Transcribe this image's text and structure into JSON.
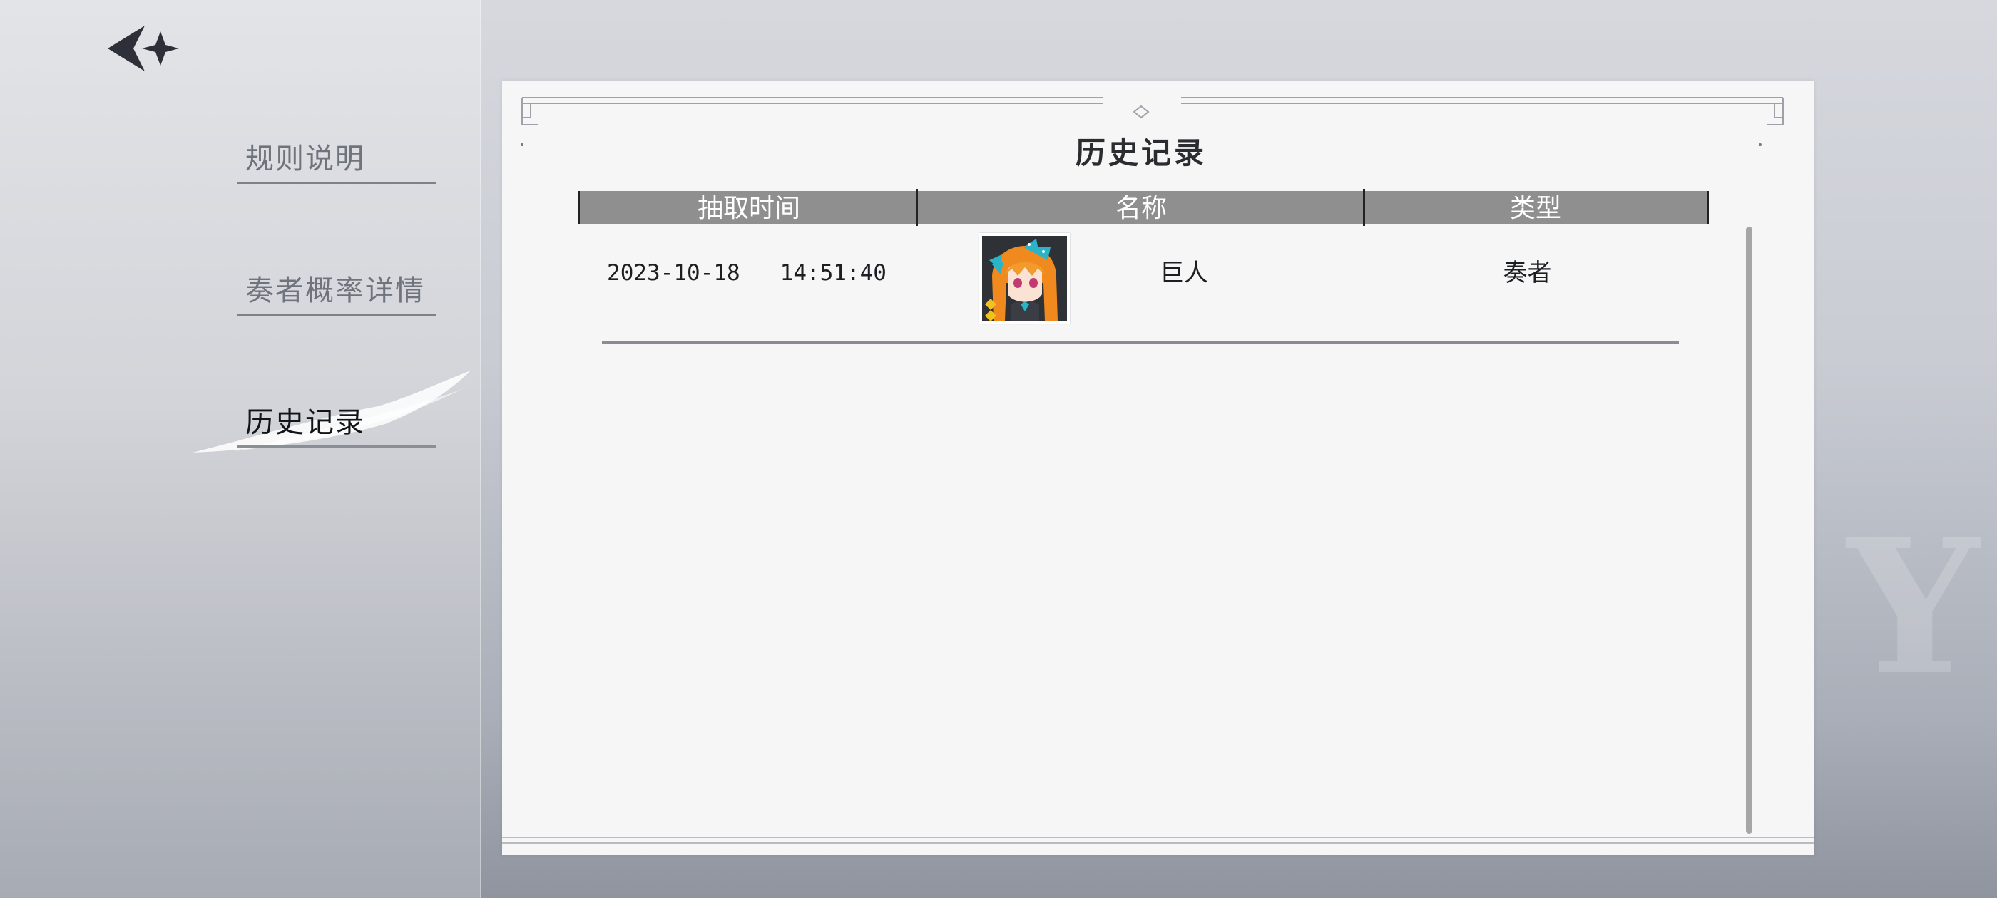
{
  "sidebar": {
    "back_icon": "back-arrow-star-icon",
    "items": [
      {
        "label": "规则说明",
        "active": false
      },
      {
        "label": "奏者概率详情",
        "active": false
      },
      {
        "label": "历史记录",
        "active": true
      }
    ]
  },
  "panel": {
    "title": "历史记录",
    "columns": [
      "抽取时间",
      "名称",
      "类型"
    ],
    "rows": [
      {
        "time": "2023-10-18   14:51:40",
        "avatar_icon": "character-portrait-orange-hair-blue-bow",
        "name": "巨人",
        "type": "奏者"
      }
    ]
  },
  "colors": {
    "header_bg": "#8f8f8f",
    "panel_bg": "#f6f6f6",
    "active_text": "#111418",
    "inactive_text": "#6f737c"
  }
}
